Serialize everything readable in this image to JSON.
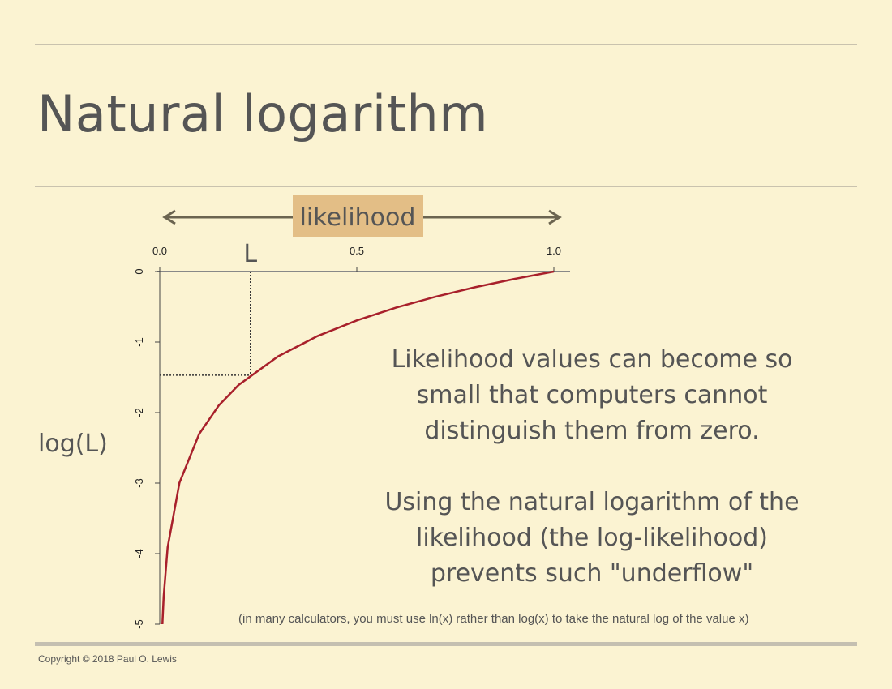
{
  "slide": {
    "title": "Natural logarithm",
    "text_block_1": [
      "Likelihood values can become so",
      "small that computers cannot",
      "distinguish them from zero."
    ],
    "text_block_2": [
      "Using the natural logarithm of the",
      "likelihood (the log-likelihood)",
      "prevents such \"underflow\""
    ],
    "note": "(in many calculators, you must use ln(x) rather than log(x) to take the natural log of the value x)",
    "copyright": "Copyright © 2018 Paul O. Lewis"
  },
  "chart_data": {
    "type": "line",
    "function": "ln(x)",
    "xlim": [
      0.0,
      1.0
    ],
    "ylim": [
      -5,
      0
    ],
    "x_ticks": [
      0.0,
      0.5,
      1.0
    ],
    "x_tick_labels": [
      "0.0",
      "0.5",
      "1.0"
    ],
    "y_ticks": [
      0,
      -1,
      -2,
      -3,
      -4,
      -5
    ],
    "y_tick_labels": [
      "0",
      "-1",
      "-2",
      "-3",
      "-4",
      "-5"
    ],
    "series": [
      {
        "x": [
          0.0067,
          0.01,
          0.02,
          0.05,
          0.1,
          0.15,
          0.2,
          0.3,
          0.4,
          0.5,
          0.6,
          0.7,
          0.8,
          0.9,
          1.0
        ],
        "y": [
          -5.0,
          -4.605,
          -3.912,
          -2.996,
          -2.303,
          -1.897,
          -1.609,
          -1.204,
          -0.916,
          -0.693,
          -0.511,
          -0.357,
          -0.223,
          -0.105,
          0.0
        ]
      }
    ],
    "marker_L": {
      "x": 0.23,
      "y": -1.47,
      "label": "L"
    },
    "xaxis_arrow_label": "likelihood",
    "ylabel": "log(L)",
    "grid": false,
    "line_color": "#a8202b",
    "label_box_color": "#e3be86",
    "arrow_color": "#6b6450"
  }
}
